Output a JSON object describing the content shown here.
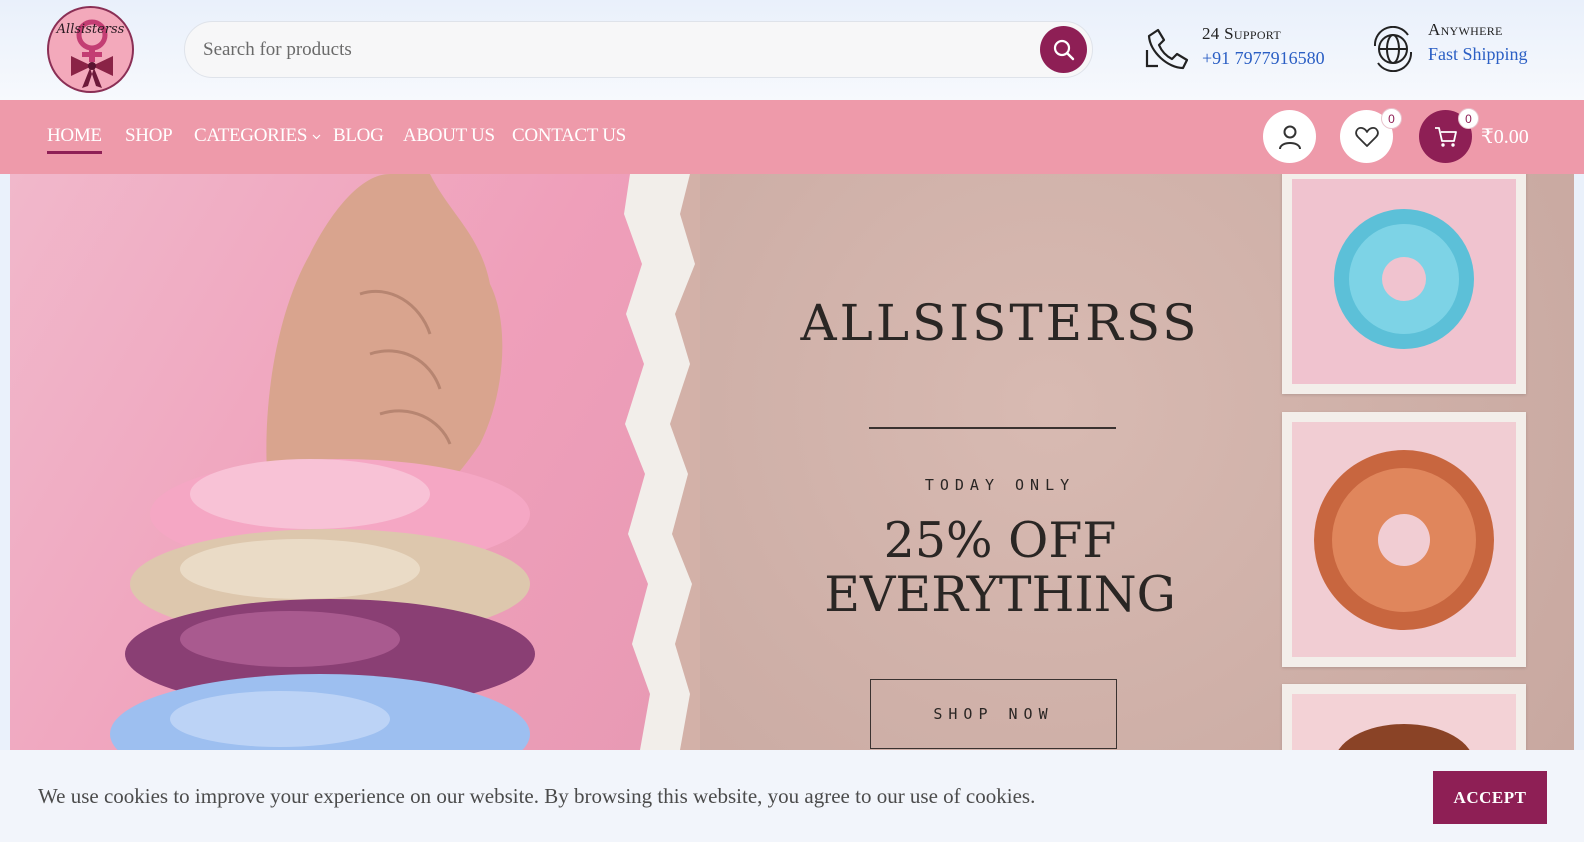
{
  "brand": {
    "logo_text": "Allsisterss"
  },
  "search": {
    "placeholder": "Search for products"
  },
  "header_info": {
    "support_title": "24 Support",
    "support_phone": "+91 7977916580",
    "shipping_title": "Anywhere",
    "shipping_value": "Fast Shipping"
  },
  "nav": {
    "items": [
      {
        "label": "HOME",
        "active": true
      },
      {
        "label": "SHOP"
      },
      {
        "label": "CATEGORIES"
      },
      {
        "label": "BLOG"
      },
      {
        "label": "ABOUT US"
      },
      {
        "label": "CONTACT US"
      }
    ]
  },
  "actions": {
    "wishlist_count": "0",
    "cart_count": "0",
    "cart_total": "₹0.00"
  },
  "hero": {
    "title": "ALLSISTERSS",
    "subtitle": "TODAY ONLY",
    "offer_line1": "25% OFF",
    "offer_line2": "EVERYTHING",
    "cta": "SHOP NOW"
  },
  "cookie": {
    "text": "We use cookies to improve your experience on our website. By browsing this website, you agree to our use of cookies.",
    "accept_label": "ACCEPT"
  },
  "colors": {
    "accent": "#8e1f55",
    "nav_bg": "#ee9aaa",
    "link_blue": "#2b5fc4"
  },
  "icons": [
    "search-icon",
    "phone-icon",
    "globe-icon",
    "user-icon",
    "heart-icon",
    "cart-icon",
    "chevron-down-icon"
  ]
}
